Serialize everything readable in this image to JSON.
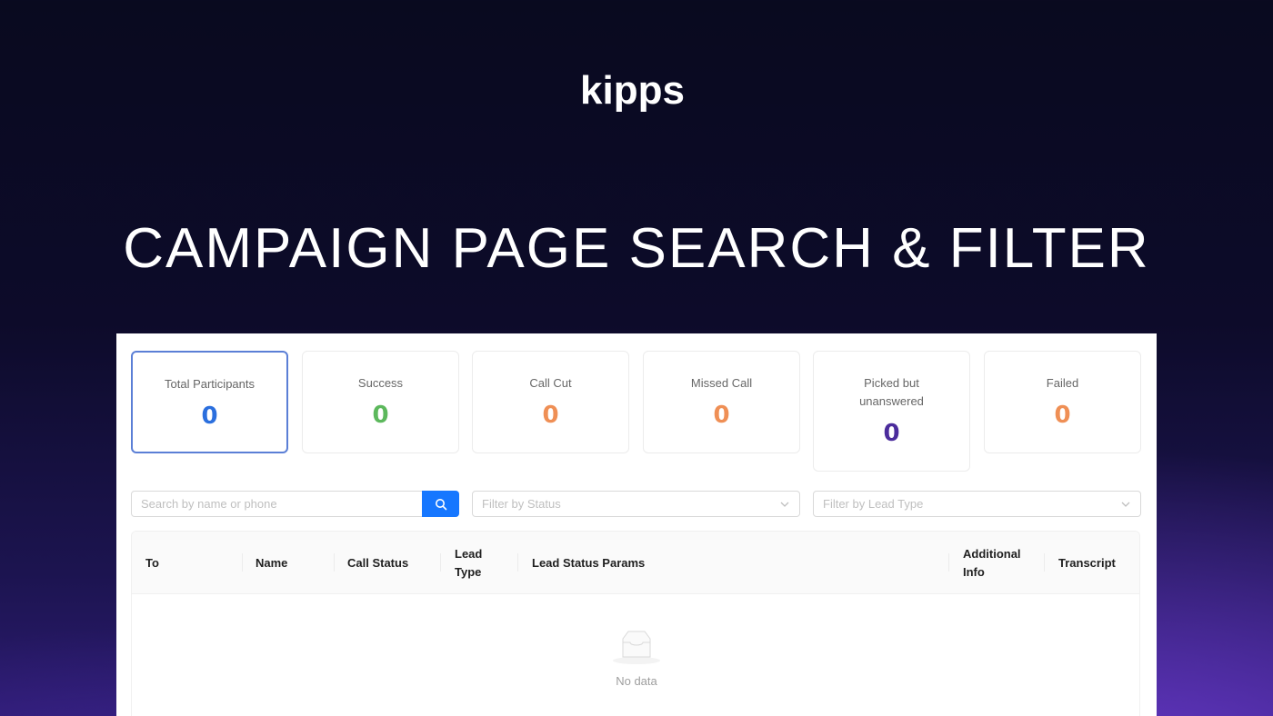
{
  "brand": {
    "logo_text": "kipps"
  },
  "hero": {
    "title": "CAMPAIGN PAGE SEARCH & FILTER"
  },
  "stats": [
    {
      "label": "Total Participants",
      "value": "0",
      "color": "#2b6fde"
    },
    {
      "label": "Success",
      "value": "0",
      "color": "#5cb85c"
    },
    {
      "label": "Call Cut",
      "value": "0",
      "color": "#ef8f55"
    },
    {
      "label": "Missed Call",
      "value": "0",
      "color": "#ef8f55"
    },
    {
      "label": "Picked but unanswered",
      "value": "0",
      "color": "#4b2c9c"
    },
    {
      "label": "Failed",
      "value": "0",
      "color": "#ef8f55"
    }
  ],
  "filters": {
    "search_placeholder": "Search by name or phone",
    "search_icon": "search-icon",
    "status_placeholder": "Filter by Status",
    "lead_type_placeholder": "Filter by Lead Type"
  },
  "table": {
    "columns": [
      "To",
      "Name",
      "Call Status",
      "Lead Type",
      "Lead Status Params",
      "Additional Info",
      "Transcript"
    ],
    "rows": [],
    "empty_text": "No data"
  },
  "colors": {
    "accent": "#1677ff",
    "active_border": "#5b7fd6"
  }
}
